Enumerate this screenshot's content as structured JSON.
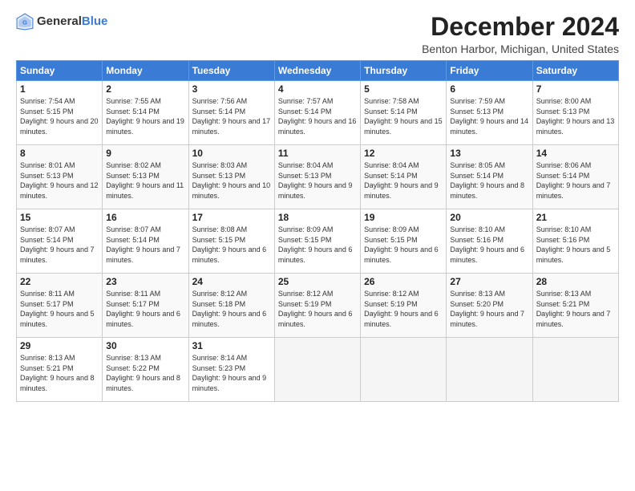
{
  "header": {
    "logo_general": "General",
    "logo_blue": "Blue",
    "month_title": "December 2024",
    "subtitle": "Benton Harbor, Michigan, United States"
  },
  "days_of_week": [
    "Sunday",
    "Monday",
    "Tuesday",
    "Wednesday",
    "Thursday",
    "Friday",
    "Saturday"
  ],
  "weeks": [
    [
      {
        "day": "1",
        "sunrise": "Sunrise: 7:54 AM",
        "sunset": "Sunset: 5:15 PM",
        "daylight": "Daylight: 9 hours and 20 minutes."
      },
      {
        "day": "2",
        "sunrise": "Sunrise: 7:55 AM",
        "sunset": "Sunset: 5:14 PM",
        "daylight": "Daylight: 9 hours and 19 minutes."
      },
      {
        "day": "3",
        "sunrise": "Sunrise: 7:56 AM",
        "sunset": "Sunset: 5:14 PM",
        "daylight": "Daylight: 9 hours and 17 minutes."
      },
      {
        "day": "4",
        "sunrise": "Sunrise: 7:57 AM",
        "sunset": "Sunset: 5:14 PM",
        "daylight": "Daylight: 9 hours and 16 minutes."
      },
      {
        "day": "5",
        "sunrise": "Sunrise: 7:58 AM",
        "sunset": "Sunset: 5:14 PM",
        "daylight": "Daylight: 9 hours and 15 minutes."
      },
      {
        "day": "6",
        "sunrise": "Sunrise: 7:59 AM",
        "sunset": "Sunset: 5:13 PM",
        "daylight": "Daylight: 9 hours and 14 minutes."
      },
      {
        "day": "7",
        "sunrise": "Sunrise: 8:00 AM",
        "sunset": "Sunset: 5:13 PM",
        "daylight": "Daylight: 9 hours and 13 minutes."
      }
    ],
    [
      {
        "day": "8",
        "sunrise": "Sunrise: 8:01 AM",
        "sunset": "Sunset: 5:13 PM",
        "daylight": "Daylight: 9 hours and 12 minutes."
      },
      {
        "day": "9",
        "sunrise": "Sunrise: 8:02 AM",
        "sunset": "Sunset: 5:13 PM",
        "daylight": "Daylight: 9 hours and 11 minutes."
      },
      {
        "day": "10",
        "sunrise": "Sunrise: 8:03 AM",
        "sunset": "Sunset: 5:13 PM",
        "daylight": "Daylight: 9 hours and 10 minutes."
      },
      {
        "day": "11",
        "sunrise": "Sunrise: 8:04 AM",
        "sunset": "Sunset: 5:13 PM",
        "daylight": "Daylight: 9 hours and 9 minutes."
      },
      {
        "day": "12",
        "sunrise": "Sunrise: 8:04 AM",
        "sunset": "Sunset: 5:14 PM",
        "daylight": "Daylight: 9 hours and 9 minutes."
      },
      {
        "day": "13",
        "sunrise": "Sunrise: 8:05 AM",
        "sunset": "Sunset: 5:14 PM",
        "daylight": "Daylight: 9 hours and 8 minutes."
      },
      {
        "day": "14",
        "sunrise": "Sunrise: 8:06 AM",
        "sunset": "Sunset: 5:14 PM",
        "daylight": "Daylight: 9 hours and 7 minutes."
      }
    ],
    [
      {
        "day": "15",
        "sunrise": "Sunrise: 8:07 AM",
        "sunset": "Sunset: 5:14 PM",
        "daylight": "Daylight: 9 hours and 7 minutes."
      },
      {
        "day": "16",
        "sunrise": "Sunrise: 8:07 AM",
        "sunset": "Sunset: 5:14 PM",
        "daylight": "Daylight: 9 hours and 7 minutes."
      },
      {
        "day": "17",
        "sunrise": "Sunrise: 8:08 AM",
        "sunset": "Sunset: 5:15 PM",
        "daylight": "Daylight: 9 hours and 6 minutes."
      },
      {
        "day": "18",
        "sunrise": "Sunrise: 8:09 AM",
        "sunset": "Sunset: 5:15 PM",
        "daylight": "Daylight: 9 hours and 6 minutes."
      },
      {
        "day": "19",
        "sunrise": "Sunrise: 8:09 AM",
        "sunset": "Sunset: 5:15 PM",
        "daylight": "Daylight: 9 hours and 6 minutes."
      },
      {
        "day": "20",
        "sunrise": "Sunrise: 8:10 AM",
        "sunset": "Sunset: 5:16 PM",
        "daylight": "Daylight: 9 hours and 6 minutes."
      },
      {
        "day": "21",
        "sunrise": "Sunrise: 8:10 AM",
        "sunset": "Sunset: 5:16 PM",
        "daylight": "Daylight: 9 hours and 5 minutes."
      }
    ],
    [
      {
        "day": "22",
        "sunrise": "Sunrise: 8:11 AM",
        "sunset": "Sunset: 5:17 PM",
        "daylight": "Daylight: 9 hours and 5 minutes."
      },
      {
        "day": "23",
        "sunrise": "Sunrise: 8:11 AM",
        "sunset": "Sunset: 5:17 PM",
        "daylight": "Daylight: 9 hours and 6 minutes."
      },
      {
        "day": "24",
        "sunrise": "Sunrise: 8:12 AM",
        "sunset": "Sunset: 5:18 PM",
        "daylight": "Daylight: 9 hours and 6 minutes."
      },
      {
        "day": "25",
        "sunrise": "Sunrise: 8:12 AM",
        "sunset": "Sunset: 5:19 PM",
        "daylight": "Daylight: 9 hours and 6 minutes."
      },
      {
        "day": "26",
        "sunrise": "Sunrise: 8:12 AM",
        "sunset": "Sunset: 5:19 PM",
        "daylight": "Daylight: 9 hours and 6 minutes."
      },
      {
        "day": "27",
        "sunrise": "Sunrise: 8:13 AM",
        "sunset": "Sunset: 5:20 PM",
        "daylight": "Daylight: 9 hours and 7 minutes."
      },
      {
        "day": "28",
        "sunrise": "Sunrise: 8:13 AM",
        "sunset": "Sunset: 5:21 PM",
        "daylight": "Daylight: 9 hours and 7 minutes."
      }
    ],
    [
      {
        "day": "29",
        "sunrise": "Sunrise: 8:13 AM",
        "sunset": "Sunset: 5:21 PM",
        "daylight": "Daylight: 9 hours and 8 minutes."
      },
      {
        "day": "30",
        "sunrise": "Sunrise: 8:13 AM",
        "sunset": "Sunset: 5:22 PM",
        "daylight": "Daylight: 9 hours and 8 minutes."
      },
      {
        "day": "31",
        "sunrise": "Sunrise: 8:14 AM",
        "sunset": "Sunset: 5:23 PM",
        "daylight": "Daylight: 9 hours and 9 minutes."
      },
      null,
      null,
      null,
      null
    ]
  ]
}
